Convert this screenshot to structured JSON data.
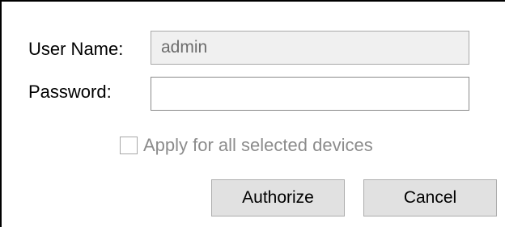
{
  "form": {
    "username_label": "User Name:",
    "username_value": "admin",
    "password_label": "Password:",
    "password_value": "",
    "apply_all_label": "Apply for all selected devices",
    "apply_all_checked": false,
    "apply_all_enabled": false
  },
  "buttons": {
    "authorize_label": "Authorize",
    "cancel_label": "Cancel"
  },
  "colors": {
    "disabled_text": "#8c8c8c",
    "readonly_field_bg": "#f0f0f0",
    "button_bg": "#e1e1e1"
  }
}
